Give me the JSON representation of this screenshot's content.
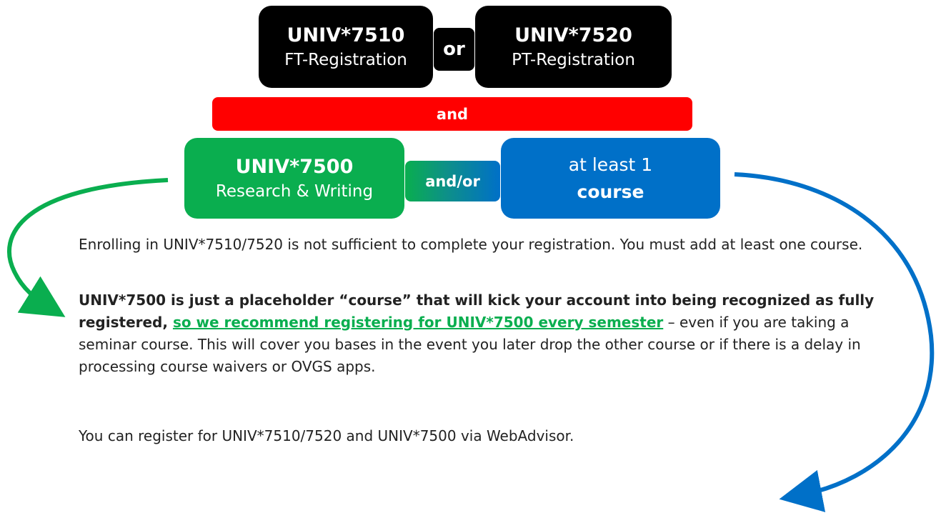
{
  "top_row": {
    "left": {
      "code": "UNIV*7510",
      "label": "FT-Registration"
    },
    "connector": "or",
    "right": {
      "code": "UNIV*7520",
      "label": "PT-Registration"
    }
  },
  "middle_bar": {
    "label": "and"
  },
  "bottom_row": {
    "left": {
      "code": "UNIV*7500",
      "label": "Research & Writing"
    },
    "connector": "and/or",
    "right": {
      "line1": "at least 1",
      "line2": "course"
    }
  },
  "paragraphs": {
    "p1": "Enrolling in UNIV*7510/7520 is not sufficient to complete your registration. You must add at least one course.",
    "p2_bold": "UNIV*7500 is just a placeholder “course” that will kick your account into being recognized as fully registered, ",
    "p2_link": "so we recommend registering for UNIV*7500 every semester",
    "p2_rest": " – even if you are taking a seminar course. This will cover you bases in the event you later drop the other course or if there is a delay in processing course waivers or OVGS apps.",
    "p3": "You can register for UNIV*7510/7520 and UNIV*7500 via WebAdvisor."
  },
  "colors": {
    "black": "#000000",
    "red": "#ff0000",
    "green": "#0aae4f",
    "blue": "#0070c8"
  }
}
